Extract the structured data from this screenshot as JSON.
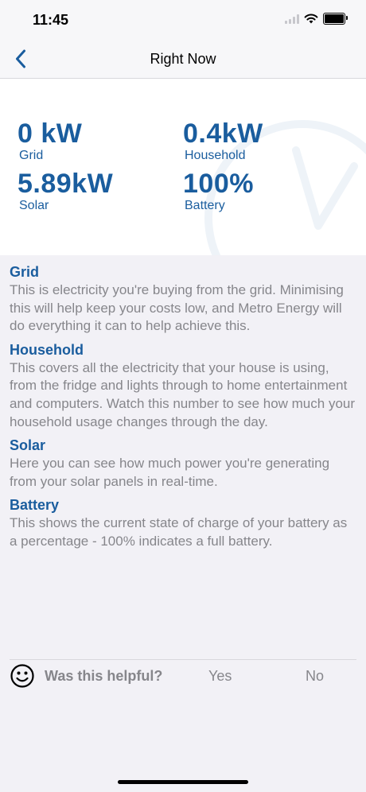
{
  "status_bar": {
    "time": "11:45"
  },
  "nav": {
    "title": "Right Now",
    "back_icon": "chevron-left-icon"
  },
  "metrics": {
    "grid": {
      "value": "0 kW",
      "label": "Grid"
    },
    "household": {
      "value": "0.4kW",
      "label": "Household"
    },
    "solar": {
      "value": "5.89kW",
      "label": "Solar"
    },
    "battery": {
      "value": "100%",
      "label": "Battery"
    }
  },
  "sections": [
    {
      "title": "Grid",
      "body": "This is electricity you're buying from the grid. Minimising this will help keep your costs low, and Metro Energy will do everything it can to help achieve this."
    },
    {
      "title": "Household",
      "body": "This covers all the electricity that your house is using, from the fridge and lights through to home entertainment and computers. Watch this number to see how much your household usage changes through the day."
    },
    {
      "title": "Solar",
      "body": "Here you can see how much power you're generating from your solar panels in real-time."
    },
    {
      "title": "Battery",
      "body": "This shows the current state of charge of your battery as a percentage - 100% indicates a full battery."
    }
  ],
  "feedback": {
    "question": "Was this helpful?",
    "yes": "Yes",
    "no": "No"
  },
  "colors": {
    "accent": "#1a5d9e",
    "muted_text": "#86868b",
    "background": "#f2f1f6"
  }
}
